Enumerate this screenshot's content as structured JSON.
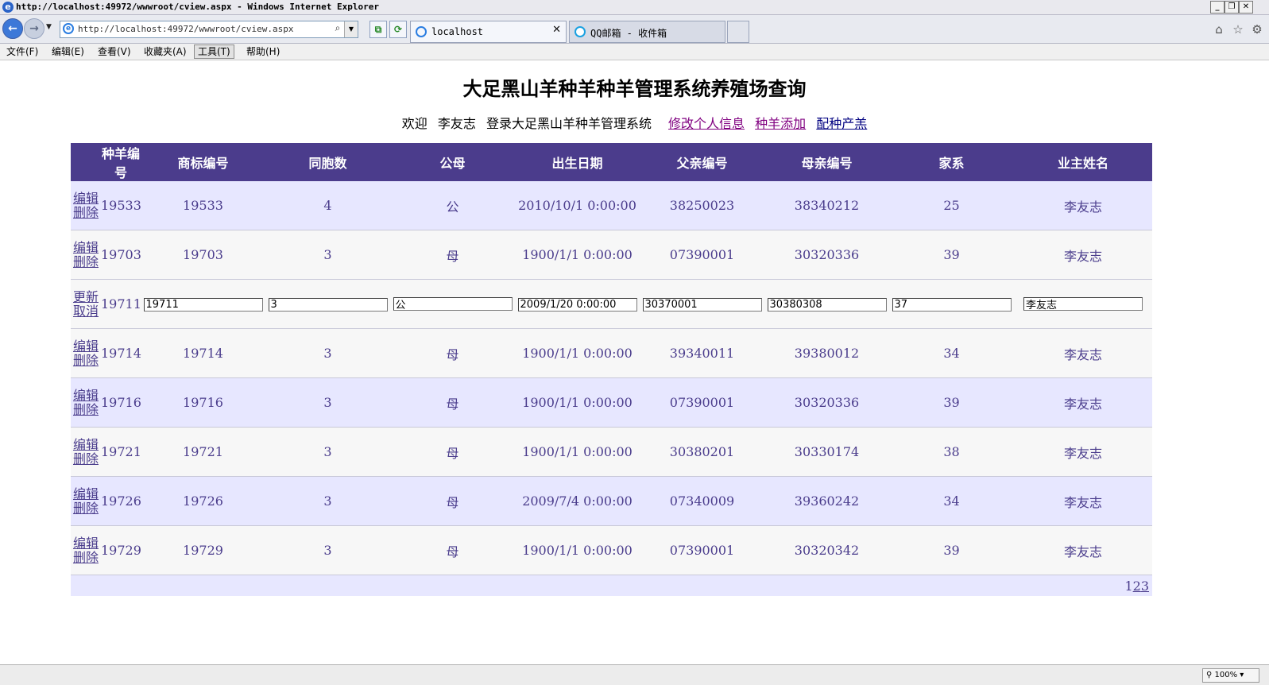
{
  "window": {
    "title": "http://localhost:49972/wwwroot/cview.aspx - Windows Internet Explorer",
    "controls": {
      "minimize": "_",
      "restore": "❐",
      "close": "✕"
    }
  },
  "browser": {
    "address": "http://localhost:49972/wwwroot/cview.aspx",
    "tabs": [
      {
        "label": "localhost",
        "close": "✕"
      },
      {
        "label": "QQ邮箱 - 收件箱"
      }
    ],
    "zoom": "100%"
  },
  "menu": {
    "file": "文件(F)",
    "edit": "编辑(E)",
    "view": "查看(V)",
    "favorites": "收藏夹(A)",
    "tools": "工具(T)",
    "help": "帮助(H)"
  },
  "page": {
    "title": "大足黑山羊种羊种羊管理系统养殖场查询",
    "welcome": {
      "greeting": "欢迎",
      "user": "李友志",
      "login_text": "登录大足黑山羊种羊管理系统",
      "links": {
        "edit_profile": "修改个人信息",
        "add_sheep": "种羊添加",
        "breeding": "配种产羔"
      }
    }
  },
  "grid": {
    "headers": {
      "id": "种羊编号",
      "trademark": "商标编号",
      "siblings": "同胞数",
      "gender": "公母",
      "birth": "出生日期",
      "father": "父亲编号",
      "mother": "母亲编号",
      "family": "家系",
      "owner": "业主姓名"
    },
    "actions": {
      "edit": "编辑",
      "delete": "删除",
      "update": "更新",
      "cancel": "取消"
    },
    "rows": [
      {
        "id": "19533",
        "trademark": "19533",
        "siblings": "4",
        "gender": "公",
        "birth": "2010/10/1 0:00:00",
        "father": "38250023",
        "mother": "38340212",
        "family": "25",
        "owner": "李友志"
      },
      {
        "id": "19703",
        "trademark": "19703",
        "siblings": "3",
        "gender": "母",
        "birth": "1900/1/1 0:00:00",
        "father": "07390001",
        "mother": "30320336",
        "family": "39",
        "owner": "李友志"
      },
      {
        "id": "19711",
        "trademark": "19711",
        "siblings": "3",
        "gender": "公",
        "birth": "2009/1/20 0:00:00",
        "father": "30370001",
        "mother": "30380308",
        "family": "37",
        "owner": "李友志"
      },
      {
        "id": "19714",
        "trademark": "19714",
        "siblings": "3",
        "gender": "母",
        "birth": "1900/1/1 0:00:00",
        "father": "39340011",
        "mother": "39380012",
        "family": "34",
        "owner": "李友志"
      },
      {
        "id": "19716",
        "trademark": "19716",
        "siblings": "3",
        "gender": "母",
        "birth": "1900/1/1 0:00:00",
        "father": "07390001",
        "mother": "30320336",
        "family": "39",
        "owner": "李友志"
      },
      {
        "id": "19721",
        "trademark": "19721",
        "siblings": "3",
        "gender": "母",
        "birth": "1900/1/1 0:00:00",
        "father": "30380201",
        "mother": "30330174",
        "family": "38",
        "owner": "李友志"
      },
      {
        "id": "19726",
        "trademark": "19726",
        "siblings": "3",
        "gender": "母",
        "birth": "2009/7/4 0:00:00",
        "father": "07340009",
        "mother": "39360242",
        "family": "34",
        "owner": "李友志"
      },
      {
        "id": "19729",
        "trademark": "19729",
        "siblings": "3",
        "gender": "母",
        "birth": "1900/1/1 0:00:00",
        "father": "07390001",
        "mother": "30320342",
        "family": "39",
        "owner": "李友志"
      }
    ],
    "pager": {
      "current": "1",
      "page2": "2",
      "page3": "3"
    }
  },
  "colors": {
    "header_bg": "#4b3c8c",
    "alt_row_bg": "#e7e7ff",
    "row_text": "#4a3c8c",
    "visited_link": "#800080"
  },
  "icons": {
    "back": "back-arrow-icon",
    "forward": "forward-arrow-icon",
    "home": "home-icon",
    "favorites": "star-icon",
    "tools": "gear-icon"
  }
}
